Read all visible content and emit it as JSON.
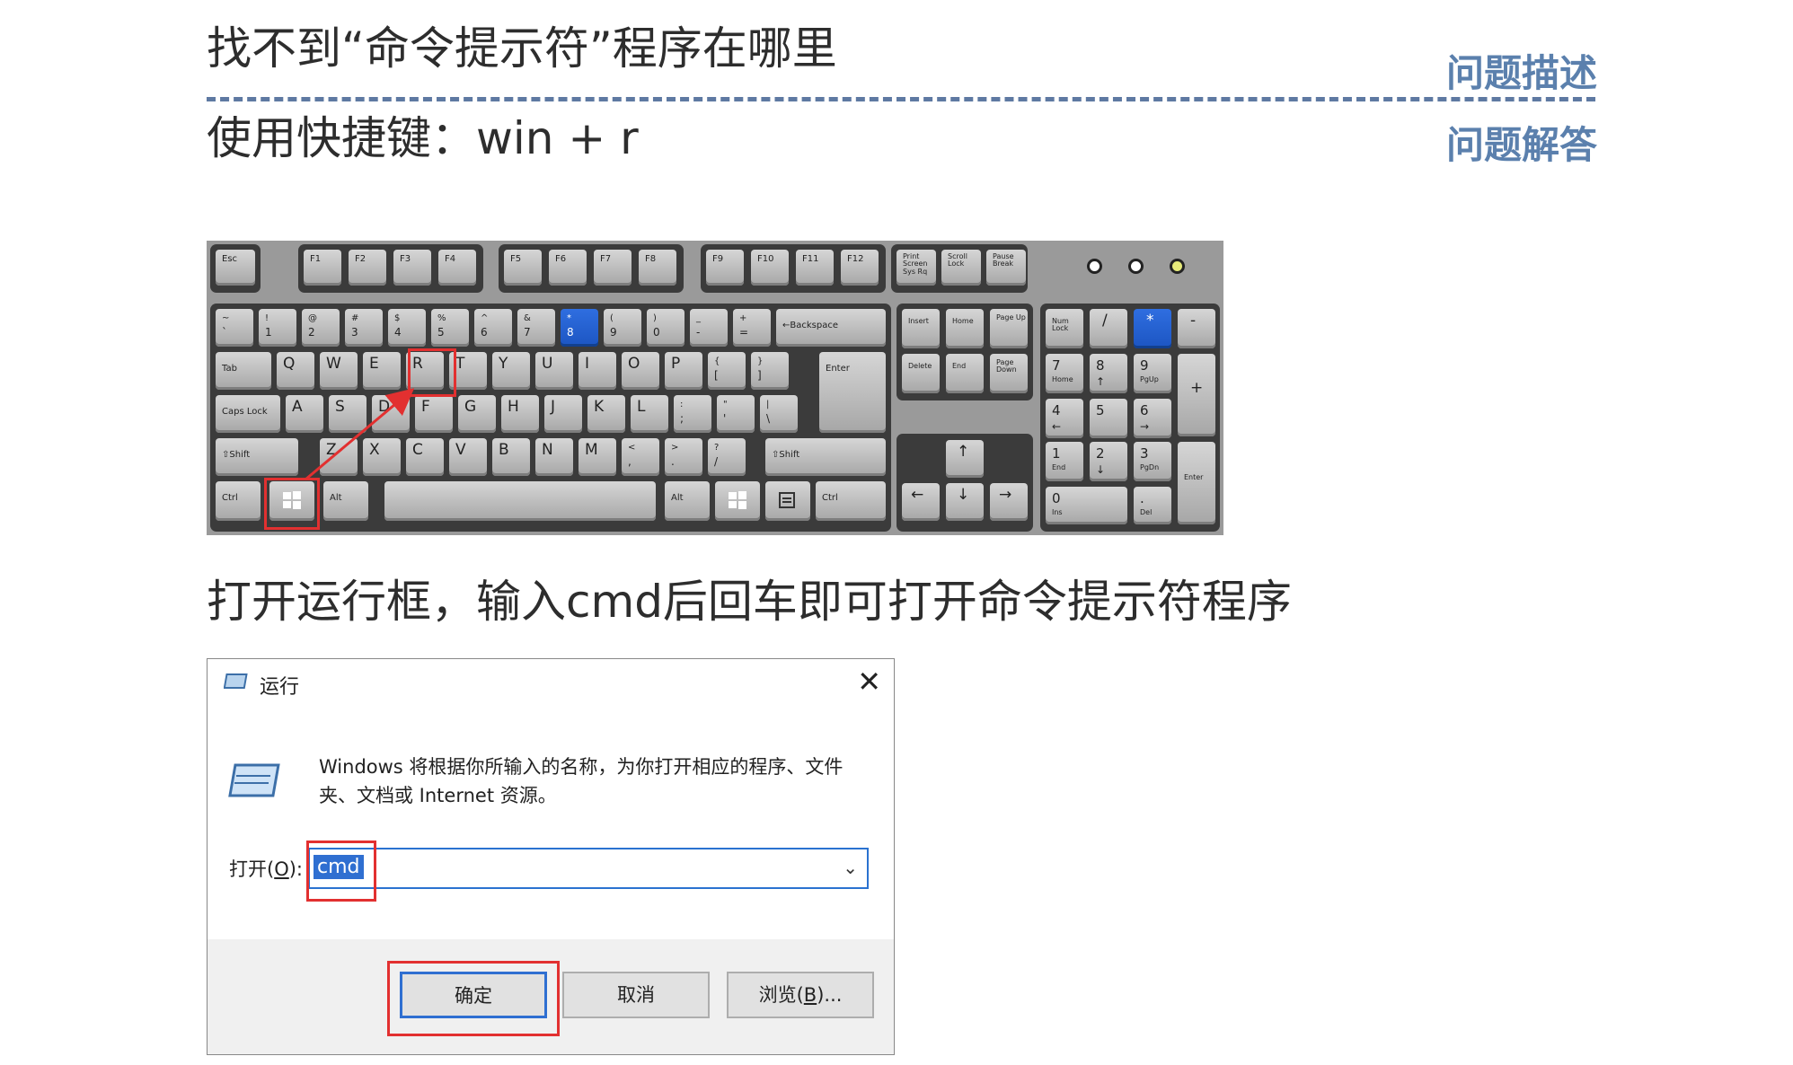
{
  "question": {
    "text": "找不到“命令提示符”程序在哪里",
    "tag": "问题描述"
  },
  "answer": {
    "text": "使用快捷键：win + r",
    "tag": "问题解答"
  },
  "step_text": "打开运行框，输入cmd后回车即可打开命令提示符程序",
  "keyboard": {
    "esc": "Esc",
    "f_keys": [
      "F1",
      "F2",
      "F3",
      "F4",
      "F5",
      "F6",
      "F7",
      "F8",
      "F9",
      "F10",
      "F11",
      "F12"
    ],
    "print": "Print Screen Sys Rq",
    "scroll": "Scroll Lock",
    "pause": "Pause Break",
    "number_row": [
      {
        "top": "~",
        "bot": "`"
      },
      {
        "top": "!",
        "bot": "1"
      },
      {
        "top": "@",
        "bot": "2"
      },
      {
        "top": "#",
        "bot": "3"
      },
      {
        "top": "$",
        "bot": "4"
      },
      {
        "top": "%",
        "bot": "5"
      },
      {
        "top": "^",
        "bot": "6"
      },
      {
        "top": "&",
        "bot": "7"
      },
      {
        "top": "*",
        "bot": "8"
      },
      {
        "top": "(",
        "bot": "9"
      },
      {
        "top": ")",
        "bot": "0"
      },
      {
        "top": "_",
        "bot": "-"
      },
      {
        "top": "+",
        "bot": "="
      }
    ],
    "backspace": "←Backspace",
    "tab": "Tab",
    "row_q": [
      "Q",
      "W",
      "E",
      "R",
      "T",
      "Y",
      "U",
      "I",
      "O",
      "P"
    ],
    "bracket_l": {
      "top": "{",
      "bot": "["
    },
    "bracket_r": {
      "top": "}",
      "bot": "]"
    },
    "enter": "Enter",
    "caps": "Caps Lock",
    "row_a": [
      "A",
      "S",
      "D",
      "F",
      "G",
      "H",
      "J",
      "K",
      "L"
    ],
    "semicolon": {
      "top": ":",
      "bot": ";"
    },
    "quote": {
      "top": "\"",
      "bot": "'"
    },
    "backslash": {
      "top": "|",
      "bot": "\\"
    },
    "shift": "⇧Shift",
    "row_z": [
      "Z",
      "X",
      "C",
      "V",
      "B",
      "N",
      "M"
    ],
    "comma": {
      "top": "<",
      "bot": ","
    },
    "period": {
      "top": ">",
      "bot": "."
    },
    "slash": {
      "top": "?",
      "bot": "/"
    },
    "ctrl": "Ctrl",
    "alt": "Alt",
    "nav": [
      "Insert",
      "Home",
      "Page Up",
      "Delete",
      "End",
      "Page Down"
    ],
    "arrows": [
      "↑",
      "←",
      "↓",
      "→"
    ],
    "numpad": {
      "numlock": "Num Lock",
      "div": "/",
      "mul": "*",
      "sub": "-",
      "add": "+",
      "n7": {
        "top": "7",
        "bot": "Home"
      },
      "n8": {
        "top": "8",
        "bot": "↑"
      },
      "n9": {
        "top": "9",
        "bot": "PgUp"
      },
      "n4": {
        "top": "4",
        "bot": "←"
      },
      "n5": {
        "top": "5",
        "bot": ""
      },
      "n6": {
        "top": "6",
        "bot": "→"
      },
      "n1": {
        "top": "1",
        "bot": "End"
      },
      "n2": {
        "top": "2",
        "bot": "↓"
      },
      "n3": {
        "top": "3",
        "bot": "PgDn"
      },
      "n0": {
        "top": "0",
        "bot": "Ins"
      },
      "ndot": {
        "top": ".",
        "bot": "Del"
      },
      "enter": "Enter"
    }
  },
  "run_dialog": {
    "title": "运行",
    "description": "Windows 将根据你所输入的名称，为你打开相应的程序、文件夹、文档或 Internet 资源。",
    "open_label_pre": "打开(",
    "open_label_key": "O",
    "open_label_post": "):",
    "input_value": "cmd",
    "ok": "确定",
    "cancel": "取消",
    "browse_pre": "浏览(",
    "browse_key": "B",
    "browse_post": ")..."
  },
  "colors": {
    "accent_blue": "#5b80ad",
    "highlight_red": "#e23030",
    "selected_blue": "#2f6fd1"
  }
}
